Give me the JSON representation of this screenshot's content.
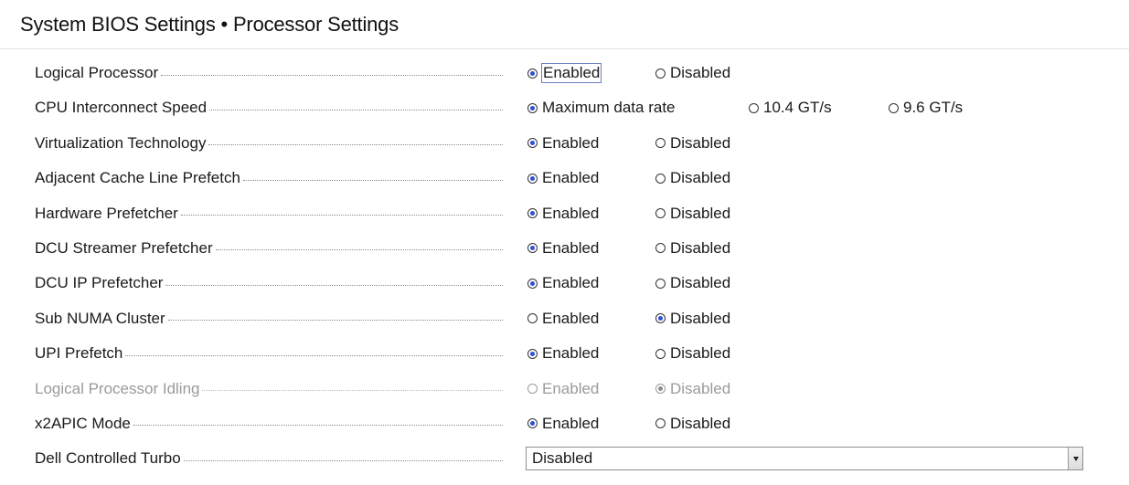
{
  "header": {
    "title": "System BIOS Settings • Processor Settings"
  },
  "settings": [
    {
      "label": "Logical Processor",
      "options": [
        {
          "text": "Enabled",
          "selected": true
        },
        {
          "text": "Disabled",
          "selected": false
        }
      ],
      "disabled": false
    },
    {
      "label": "CPU Interconnect Speed",
      "options": [
        {
          "text": "Maximum data rate",
          "selected": true
        },
        {
          "text": "10.4 GT/s",
          "selected": false
        },
        {
          "text": "9.6 GT/s",
          "selected": false
        }
      ],
      "disabled": false
    },
    {
      "label": "Virtualization Technology",
      "options": [
        {
          "text": "Enabled",
          "selected": true
        },
        {
          "text": "Disabled",
          "selected": false
        }
      ],
      "disabled": false
    },
    {
      "label": "Adjacent Cache Line Prefetch",
      "options": [
        {
          "text": "Enabled",
          "selected": true
        },
        {
          "text": "Disabled",
          "selected": false
        }
      ],
      "disabled": false
    },
    {
      "label": "Hardware Prefetcher",
      "options": [
        {
          "text": "Enabled",
          "selected": true
        },
        {
          "text": "Disabled",
          "selected": false
        }
      ],
      "disabled": false
    },
    {
      "label": "DCU Streamer Prefetcher",
      "options": [
        {
          "text": "Enabled",
          "selected": true
        },
        {
          "text": "Disabled",
          "selected": false
        }
      ],
      "disabled": false
    },
    {
      "label": "DCU IP Prefetcher",
      "options": [
        {
          "text": "Enabled",
          "selected": true
        },
        {
          "text": "Disabled",
          "selected": false
        }
      ],
      "disabled": false
    },
    {
      "label": "Sub NUMA Cluster",
      "options": [
        {
          "text": "Enabled",
          "selected": false
        },
        {
          "text": "Disabled",
          "selected": true
        }
      ],
      "disabled": false
    },
    {
      "label": "UPI Prefetch",
      "options": [
        {
          "text": "Enabled",
          "selected": true
        },
        {
          "text": "Disabled",
          "selected": false
        }
      ],
      "disabled": false
    },
    {
      "label": "Logical Processor Idling",
      "options": [
        {
          "text": "Enabled",
          "selected": false
        },
        {
          "text": "Disabled",
          "selected": true
        }
      ],
      "disabled": true
    },
    {
      "label": "x2APIC Mode",
      "options": [
        {
          "text": "Enabled",
          "selected": true
        },
        {
          "text": "Disabled",
          "selected": false
        }
      ],
      "disabled": false
    }
  ],
  "dropdown_setting": {
    "label": "Dell Controlled Turbo",
    "value": "Disabled",
    "icon": "chevron-down-icon"
  },
  "colors": {
    "radio_selected": "#2f4fd6",
    "disabled_text": "#9a9a9a",
    "focus_outline": "#6d7fbe"
  }
}
